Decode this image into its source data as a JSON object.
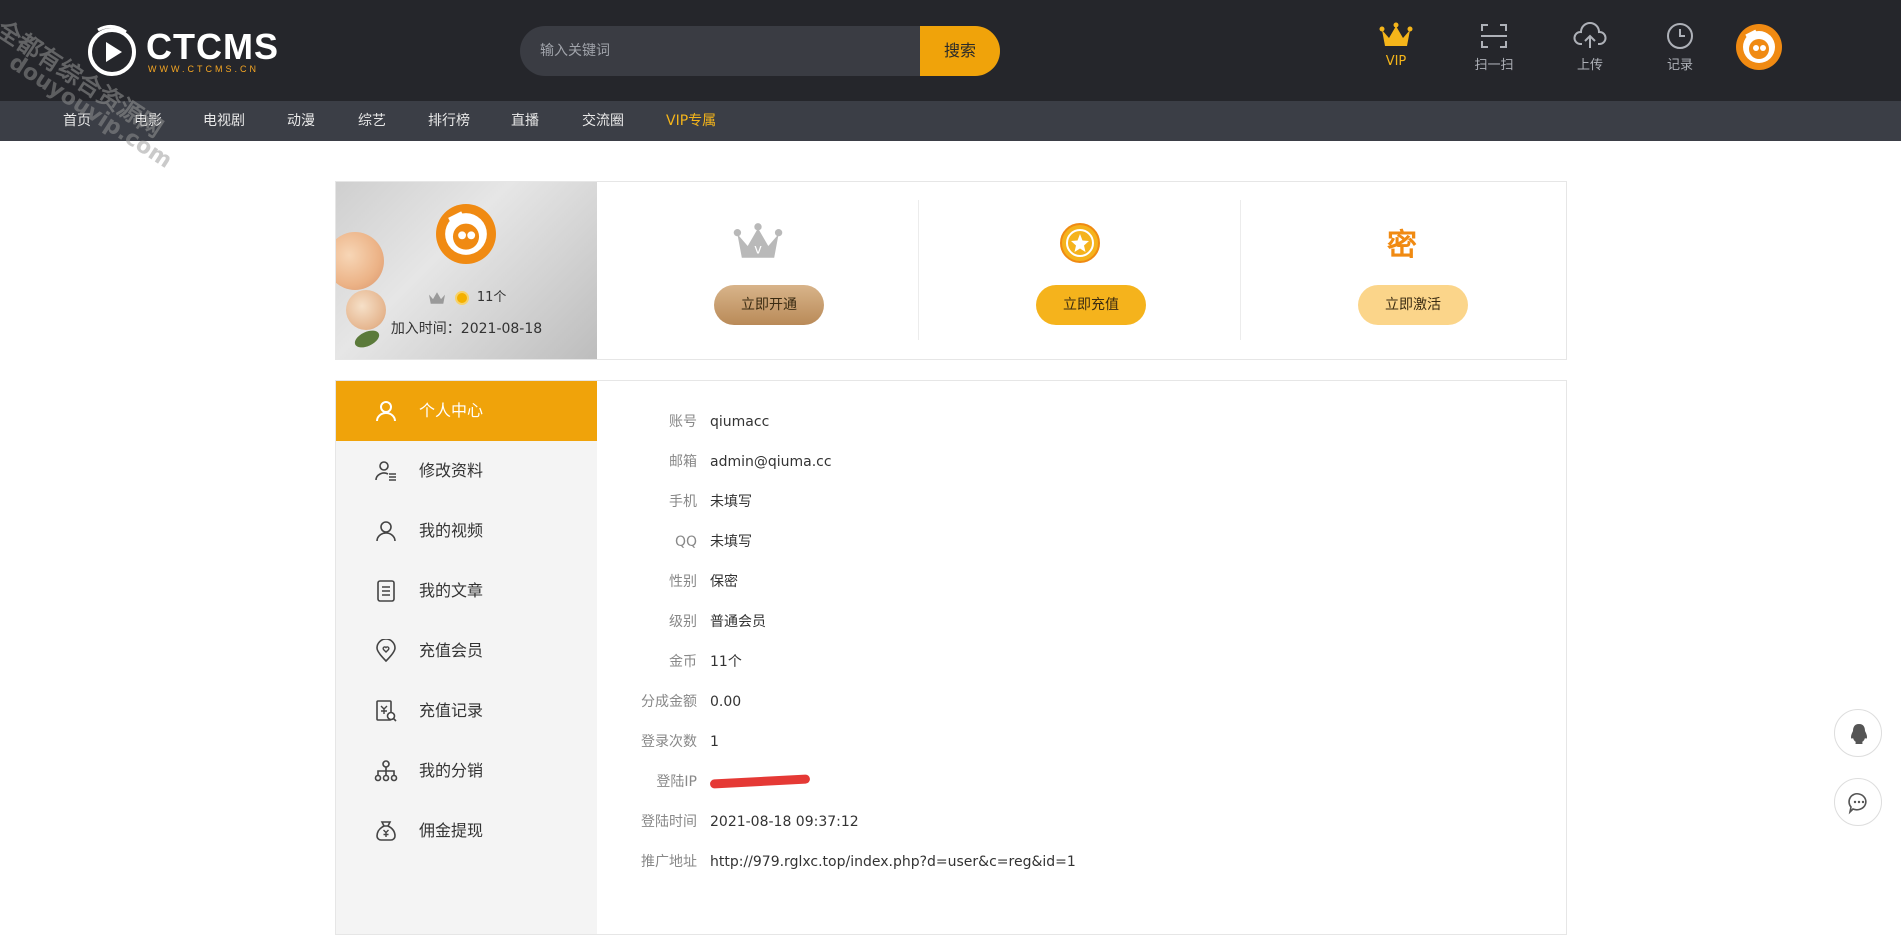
{
  "header": {
    "logo_text": "CTCMS",
    "logo_sub": "WWW.CTCMS.CN",
    "search_placeholder": "输入关键词",
    "search_button": "搜索",
    "vip_label": "VIP",
    "scan_label": "扫一扫",
    "upload_label": "上传",
    "history_label": "记录"
  },
  "nav": {
    "items": [
      "首页",
      "电影",
      "电视剧",
      "动漫",
      "综艺",
      "排行榜",
      "直播",
      "交流圈",
      "VIP专属"
    ]
  },
  "profile": {
    "coins": "11个",
    "join_time": "加入时间：2021-08-18"
  },
  "actions": {
    "vip_button": "立即开通",
    "recharge_button": "立即充值",
    "activate_button": "立即激活",
    "activate_icon_text": "密"
  },
  "sidebar": {
    "items": [
      "个人中心",
      "修改资料",
      "我的视频",
      "我的文章",
      "充值会员",
      "充值记录",
      "我的分销",
      "佣金提现"
    ]
  },
  "account": {
    "rows": [
      {
        "label": "账号",
        "value": "qiumacc"
      },
      {
        "label": "邮箱",
        "value": "admin@qiuma.cc"
      },
      {
        "label": "手机",
        "value": "未填写"
      },
      {
        "label": "QQ",
        "value": "未填写"
      },
      {
        "label": "性别",
        "value": "保密"
      },
      {
        "label": "级别",
        "value": "普通会员"
      },
      {
        "label": "金币",
        "value": "11个"
      },
      {
        "label": "分成金额",
        "value": "0.00"
      },
      {
        "label": "登录次数",
        "value": "1"
      },
      {
        "label": "登陆IP",
        "value": ""
      },
      {
        "label": "登陆时间",
        "value": "2021-08-18 09:37:12"
      },
      {
        "label": "推广地址",
        "value": "http://979.rglxc.top/index.php?d=user&c=reg&id=1"
      }
    ]
  },
  "watermark": {
    "line1": "全都有综合资源网",
    "line2": "douyouvip.com"
  },
  "colors": {
    "accent": "#f0a30a",
    "header_bg": "#25262b",
    "nav_bg": "#3b3e46",
    "vip_gold": "#f5b51a"
  }
}
